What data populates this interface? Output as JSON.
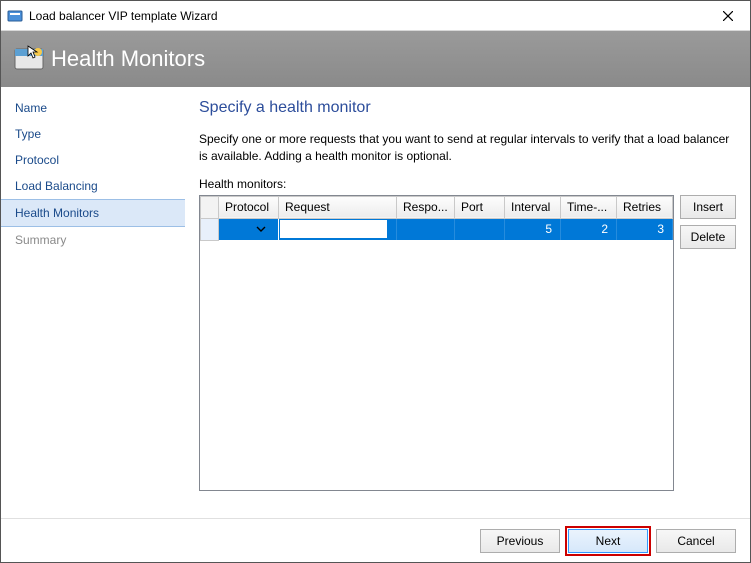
{
  "window": {
    "title": "Load balancer VIP template Wizard"
  },
  "banner": {
    "title": "Health Monitors"
  },
  "sidebar": {
    "items": [
      {
        "label": "Name"
      },
      {
        "label": "Type"
      },
      {
        "label": "Protocol"
      },
      {
        "label": "Load Balancing"
      },
      {
        "label": "Health Monitors"
      },
      {
        "label": "Summary"
      }
    ]
  },
  "main": {
    "heading": "Specify a health monitor",
    "description": "Specify one or more requests that you want to send at regular intervals to verify that a load balancer is available. Adding a health monitor is optional.",
    "grid_label": "Health monitors:",
    "columns": {
      "protocol": "Protocol",
      "request": "Request",
      "response": "Respo...",
      "port": "Port",
      "interval": "Interval",
      "timeout": "Time-...",
      "retries": "Retries"
    },
    "rows": [
      {
        "protocol": "",
        "request": "",
        "response": "",
        "port": "",
        "interval": "5",
        "timeout": "2",
        "retries": "3"
      }
    ],
    "buttons": {
      "insert": "Insert",
      "delete": "Delete"
    }
  },
  "footer": {
    "previous": "Previous",
    "next": "Next",
    "cancel": "Cancel"
  }
}
